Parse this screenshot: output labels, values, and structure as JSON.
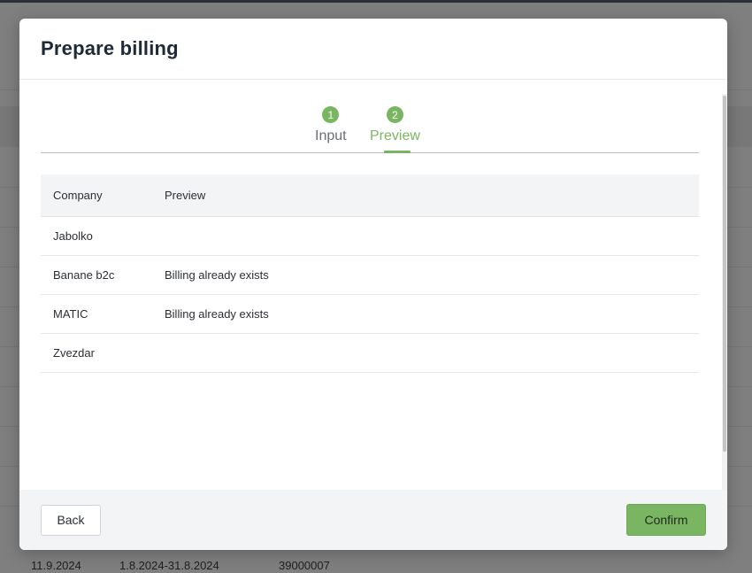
{
  "background": {
    "row": {
      "date": "11.9.2024",
      "period": "1.8.2024-31.8.2024",
      "number": "39000007"
    }
  },
  "modal": {
    "title": "Prepare billing",
    "steps": [
      {
        "number": "1",
        "label": "Input",
        "active": false
      },
      {
        "number": "2",
        "label": "Preview",
        "active": true
      }
    ],
    "table": {
      "headers": {
        "company": "Company",
        "preview": "Preview"
      },
      "rows": [
        {
          "company": "Jabolko",
          "preview": ""
        },
        {
          "company": "Banane b2c",
          "preview": "Billing already exists"
        },
        {
          "company": "MATIC",
          "preview": "Billing already exists"
        },
        {
          "company": "Zvezdar",
          "preview": ""
        }
      ]
    },
    "footer": {
      "back_label": "Back",
      "confirm_label": "Confirm"
    }
  },
  "colors": {
    "accent": "#7ab661",
    "overlay": "#7f7f7f"
  }
}
